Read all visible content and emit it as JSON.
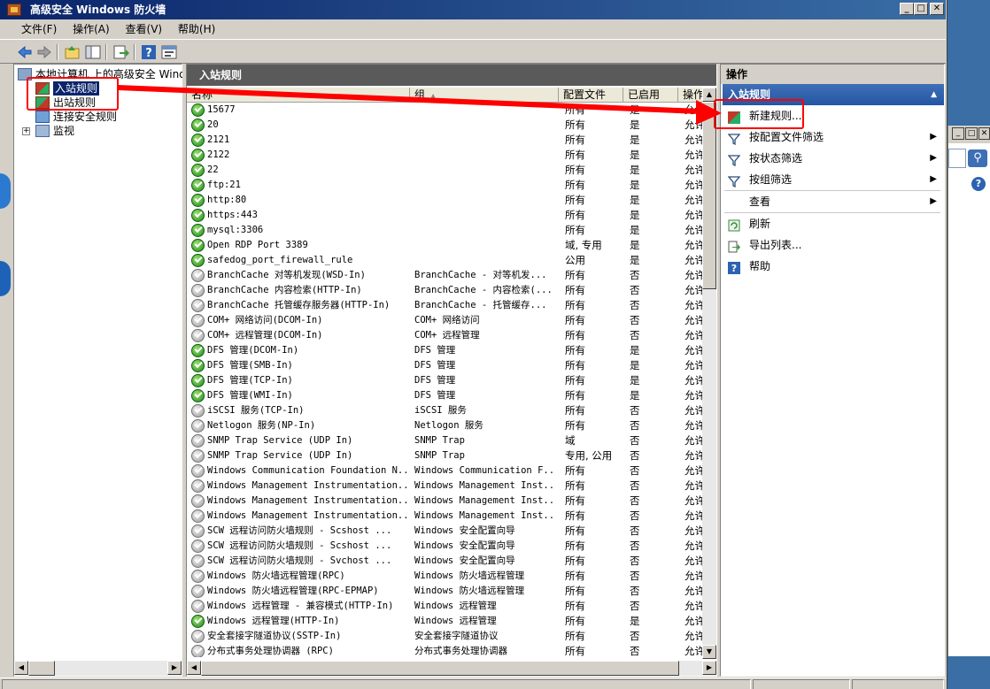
{
  "window": {
    "title": "高级安全 Windows 防火墙"
  },
  "menu": [
    "文件(F)",
    "操作(A)",
    "查看(V)",
    "帮助(H)"
  ],
  "tree": {
    "root": "本地计算机 上的高级安全 Windows",
    "items": [
      "入站规则",
      "出站规则",
      "连接安全规则",
      "监视"
    ]
  },
  "center": {
    "title": "入站规则",
    "columns": [
      "名称",
      "组",
      "配置文件",
      "已启用",
      "操作"
    ],
    "rows": [
      {
        "name": "15677",
        "group": "",
        "profile": "所有",
        "enabled": "是",
        "action": "允许",
        "status": "on"
      },
      {
        "name": "20",
        "group": "",
        "profile": "所有",
        "enabled": "是",
        "action": "允许",
        "status": "on"
      },
      {
        "name": "2121",
        "group": "",
        "profile": "所有",
        "enabled": "是",
        "action": "允许",
        "status": "on"
      },
      {
        "name": "2122",
        "group": "",
        "profile": "所有",
        "enabled": "是",
        "action": "允许",
        "status": "on"
      },
      {
        "name": "22",
        "group": "",
        "profile": "所有",
        "enabled": "是",
        "action": "允许",
        "status": "on"
      },
      {
        "name": "ftp:21",
        "group": "",
        "profile": "所有",
        "enabled": "是",
        "action": "允许",
        "status": "on"
      },
      {
        "name": "http:80",
        "group": "",
        "profile": "所有",
        "enabled": "是",
        "action": "允许",
        "status": "on"
      },
      {
        "name": "https:443",
        "group": "",
        "profile": "所有",
        "enabled": "是",
        "action": "允许",
        "status": "on"
      },
      {
        "name": "mysql:3306",
        "group": "",
        "profile": "所有",
        "enabled": "是",
        "action": "允许",
        "status": "on"
      },
      {
        "name": "Open RDP Port 3389",
        "group": "",
        "profile": "域, 专用",
        "enabled": "是",
        "action": "允许",
        "status": "on"
      },
      {
        "name": "safedog_port_firewall_rule",
        "group": "",
        "profile": "公用",
        "enabled": "是",
        "action": "允许",
        "status": "on"
      },
      {
        "name": "BranchCache 对等机发现(WSD-In)",
        "group": "BranchCache - 对等机发...",
        "profile": "所有",
        "enabled": "否",
        "action": "允许",
        "status": "off"
      },
      {
        "name": "BranchCache 内容检索(HTTP-In)",
        "group": "BranchCache - 内容检索(...",
        "profile": "所有",
        "enabled": "否",
        "action": "允许",
        "status": "off"
      },
      {
        "name": "BranchCache 托管缓存服务器(HTTP-In)",
        "group": "BranchCache - 托管缓存...",
        "profile": "所有",
        "enabled": "否",
        "action": "允许",
        "status": "off"
      },
      {
        "name": "COM+ 网络访问(DCOM-In)",
        "group": "COM+ 网络访问",
        "profile": "所有",
        "enabled": "否",
        "action": "允许",
        "status": "off"
      },
      {
        "name": "COM+ 远程管理(DCOM-In)",
        "group": "COM+ 远程管理",
        "profile": "所有",
        "enabled": "否",
        "action": "允许",
        "status": "off"
      },
      {
        "name": "DFS 管理(DCOM-In)",
        "group": "DFS 管理",
        "profile": "所有",
        "enabled": "是",
        "action": "允许",
        "status": "on"
      },
      {
        "name": "DFS 管理(SMB-In)",
        "group": "DFS 管理",
        "profile": "所有",
        "enabled": "是",
        "action": "允许",
        "status": "on"
      },
      {
        "name": "DFS 管理(TCP-In)",
        "group": "DFS 管理",
        "profile": "所有",
        "enabled": "是",
        "action": "允许",
        "status": "on"
      },
      {
        "name": "DFS 管理(WMI-In)",
        "group": "DFS 管理",
        "profile": "所有",
        "enabled": "是",
        "action": "允许",
        "status": "on"
      },
      {
        "name": "iSCSI 服务(TCP-In)",
        "group": "iSCSI 服务",
        "profile": "所有",
        "enabled": "否",
        "action": "允许",
        "status": "off"
      },
      {
        "name": "Netlogon 服务(NP-In)",
        "group": "Netlogon 服务",
        "profile": "所有",
        "enabled": "否",
        "action": "允许",
        "status": "off"
      },
      {
        "name": "SNMP Trap Service (UDP In)",
        "group": "SNMP Trap",
        "profile": "域",
        "enabled": "否",
        "action": "允许",
        "status": "off"
      },
      {
        "name": "SNMP Trap Service (UDP In)",
        "group": "SNMP Trap",
        "profile": "专用, 公用",
        "enabled": "否",
        "action": "允许",
        "status": "off"
      },
      {
        "name": "Windows Communication Foundation N...",
        "group": "Windows Communication F...",
        "profile": "所有",
        "enabled": "否",
        "action": "允许",
        "status": "off"
      },
      {
        "name": "Windows Management Instrumentation...",
        "group": "Windows Management Inst...",
        "profile": "所有",
        "enabled": "否",
        "action": "允许",
        "status": "off"
      },
      {
        "name": "Windows Management Instrumentation...",
        "group": "Windows Management Inst...",
        "profile": "所有",
        "enabled": "否",
        "action": "允许",
        "status": "off"
      },
      {
        "name": "Windows Management Instrumentation...",
        "group": "Windows Management Inst...",
        "profile": "所有",
        "enabled": "否",
        "action": "允许",
        "status": "off"
      },
      {
        "name": "SCW 远程访问防火墙规则 - Scshost ...",
        "group": "Windows 安全配置向导",
        "profile": "所有",
        "enabled": "否",
        "action": "允许",
        "status": "off"
      },
      {
        "name": "SCW 远程访问防火墙规则 - Scshost ...",
        "group": "Windows 安全配置向导",
        "profile": "所有",
        "enabled": "否",
        "action": "允许",
        "status": "off"
      },
      {
        "name": "SCW 远程访问防火墙规则 - Svchost ...",
        "group": "Windows 安全配置向导",
        "profile": "所有",
        "enabled": "否",
        "action": "允许",
        "status": "off"
      },
      {
        "name": "Windows 防火墙远程管理(RPC)",
        "group": "Windows 防火墙远程管理",
        "profile": "所有",
        "enabled": "否",
        "action": "允许",
        "status": "off"
      },
      {
        "name": "Windows 防火墙远程管理(RPC-EPMAP)",
        "group": "Windows 防火墙远程管理",
        "profile": "所有",
        "enabled": "否",
        "action": "允许",
        "status": "off"
      },
      {
        "name": "Windows 远程管理 - 兼容模式(HTTP-In)",
        "group": "Windows 远程管理",
        "profile": "所有",
        "enabled": "否",
        "action": "允许",
        "status": "off"
      },
      {
        "name": "Windows 远程管理(HTTP-In)",
        "group": "Windows 远程管理",
        "profile": "所有",
        "enabled": "是",
        "action": "允许",
        "status": "on"
      },
      {
        "name": "安全套接字隧道协议(SSTP-In)",
        "group": "安全套接字隧道协议",
        "profile": "所有",
        "enabled": "否",
        "action": "允许",
        "status": "off"
      },
      {
        "name": "分布式事务处理协调器 (RPC)",
        "group": "分布式事务处理协调器",
        "profile": "所有",
        "enabled": "否",
        "action": "允许",
        "status": "off"
      }
    ]
  },
  "actions": {
    "title": "操作",
    "section": "入站规则",
    "items": [
      {
        "label": "新建规则...",
        "icon": "new-rule-icon",
        "submenu": false
      },
      {
        "label": "按配置文件筛选",
        "icon": "filter-icon",
        "submenu": true
      },
      {
        "label": "按状态筛选",
        "icon": "filter-icon",
        "submenu": true
      },
      {
        "label": "按组筛选",
        "icon": "filter-icon",
        "submenu": true
      },
      {
        "label": "查看",
        "icon": "",
        "submenu": true
      },
      {
        "label": "刷新",
        "icon": "refresh-icon",
        "submenu": false
      },
      {
        "label": "导出列表...",
        "icon": "export-icon",
        "submenu": false
      },
      {
        "label": "帮助",
        "icon": "help-icon",
        "submenu": false
      }
    ]
  },
  "colors": {
    "highlight": "#ff0000",
    "title_bar": "#0a246a",
    "section_header": "#5a5a5a",
    "action_header": "#2456a4"
  }
}
